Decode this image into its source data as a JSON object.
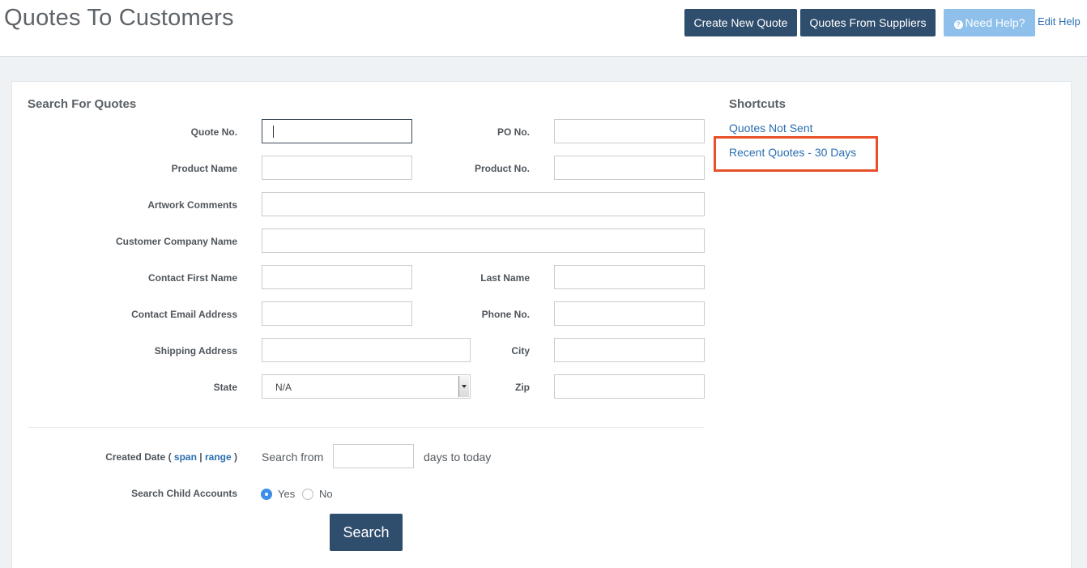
{
  "header": {
    "title": "Quotes To Customers",
    "create_quote": "Create New Quote",
    "quotes_from_suppliers": "Quotes From Suppliers",
    "need_help": "Need Help?",
    "edit_help": "Edit Help"
  },
  "search": {
    "title": "Search For Quotes",
    "labels": {
      "quote_no": "Quote No.",
      "po_no": "PO No.",
      "product_name": "Product Name",
      "product_no": "Product No.",
      "artwork_comments": "Artwork Comments",
      "customer_company_name": "Customer Company Name",
      "contact_first_name": "Contact First Name",
      "last_name": "Last Name",
      "contact_email": "Contact Email Address",
      "phone_no": "Phone No.",
      "shipping_address": "Shipping Address",
      "city": "City",
      "state": "State",
      "zip": "Zip"
    },
    "state_value": "N/A",
    "created_date": {
      "label_prefix": "Created Date (",
      "span": "span",
      "sep": "|",
      "range": "range",
      "label_suffix": ")",
      "search_from": "Search from",
      "days_to_today": "days to today"
    },
    "child_accounts": {
      "label": "Search Child Accounts",
      "yes": "Yes",
      "no": "No",
      "selected": "Yes"
    },
    "search_button": "Search"
  },
  "shortcuts": {
    "title": "Shortcuts",
    "items": [
      "Quotes Not Sent",
      "Recent Quotes - 30 Days"
    ]
  },
  "colors": {
    "primary_button": "#2f4d6c",
    "help_button": "#8ec0eb",
    "link": "#2a6eb0",
    "highlight": "#e8502a"
  }
}
